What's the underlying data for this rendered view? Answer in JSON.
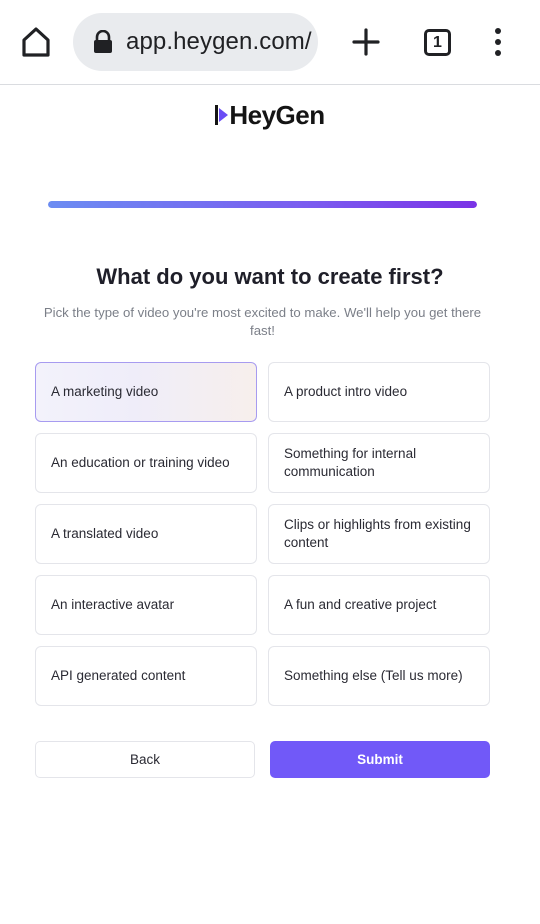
{
  "browser": {
    "url": "app.heygen.com/",
    "tab_count": "1"
  },
  "brand": {
    "logo_text": "HeyGen",
    "accent": "#7159f8"
  },
  "onboarding": {
    "progress_fraction": 1.0,
    "title": "What do you want to create first?",
    "subtitle": "Pick the type of video you're most excited to make. We'll help you get there fast!",
    "options": [
      {
        "label": "A marketing video",
        "selected": true
      },
      {
        "label": "A product intro video",
        "selected": false
      },
      {
        "label": "An education or training video",
        "selected": false
      },
      {
        "label": "Something for internal communication",
        "selected": false
      },
      {
        "label": "A translated video",
        "selected": false
      },
      {
        "label": "Clips or highlights from existing content",
        "selected": false
      },
      {
        "label": "An interactive avatar",
        "selected": false
      },
      {
        "label": "A fun and creative project",
        "selected": false
      },
      {
        "label": "API generated content",
        "selected": false
      },
      {
        "label": "Something else (Tell us more)",
        "selected": false
      }
    ],
    "back_label": "Back",
    "submit_label": "Submit"
  }
}
